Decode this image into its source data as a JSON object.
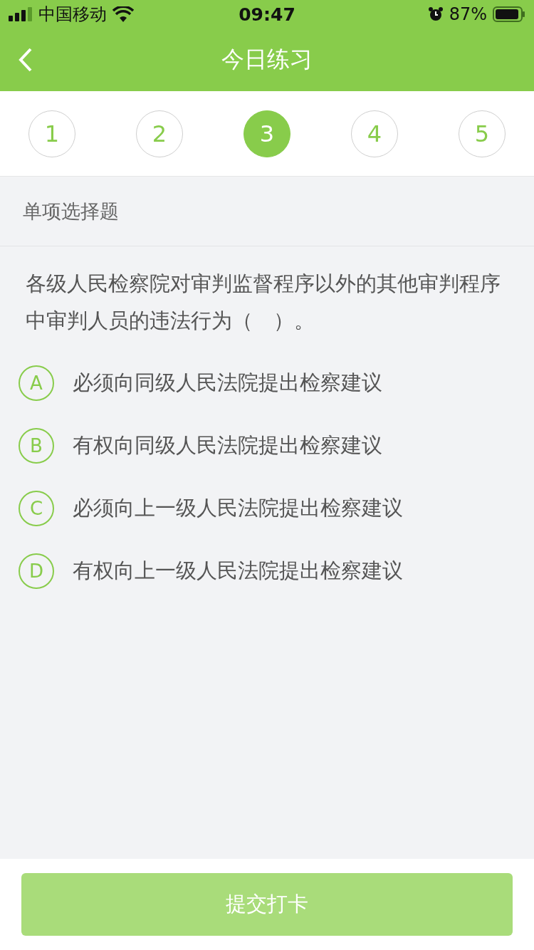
{
  "status_bar": {
    "carrier": "中国移动",
    "time": "09:47",
    "battery": "87%"
  },
  "nav": {
    "title": "今日练习"
  },
  "steps": [
    {
      "label": "1",
      "selected": false
    },
    {
      "label": "2",
      "selected": false
    },
    {
      "label": "3",
      "selected": true
    },
    {
      "label": "4",
      "selected": false
    },
    {
      "label": "5",
      "selected": false
    }
  ],
  "section": {
    "title": "单项选择题"
  },
  "question": {
    "text": "各级人民检察院对审判监督程序以外的其他审判程序中审判人员的违法行为（　）。",
    "options": [
      {
        "letter": "A",
        "text": "必须向同级人民法院提出检察建议",
        "selected": false
      },
      {
        "letter": "B",
        "text": "有权向同级人民法院提出检察建议",
        "selected": false
      },
      {
        "letter": "C",
        "text": "必须向上一级人民法院提出检察建议",
        "selected": false
      },
      {
        "letter": "D",
        "text": "有权向上一级人民法院提出检察建议",
        "selected": false
      }
    ]
  },
  "submit": {
    "label": "提交打卡",
    "disabled": true
  }
}
